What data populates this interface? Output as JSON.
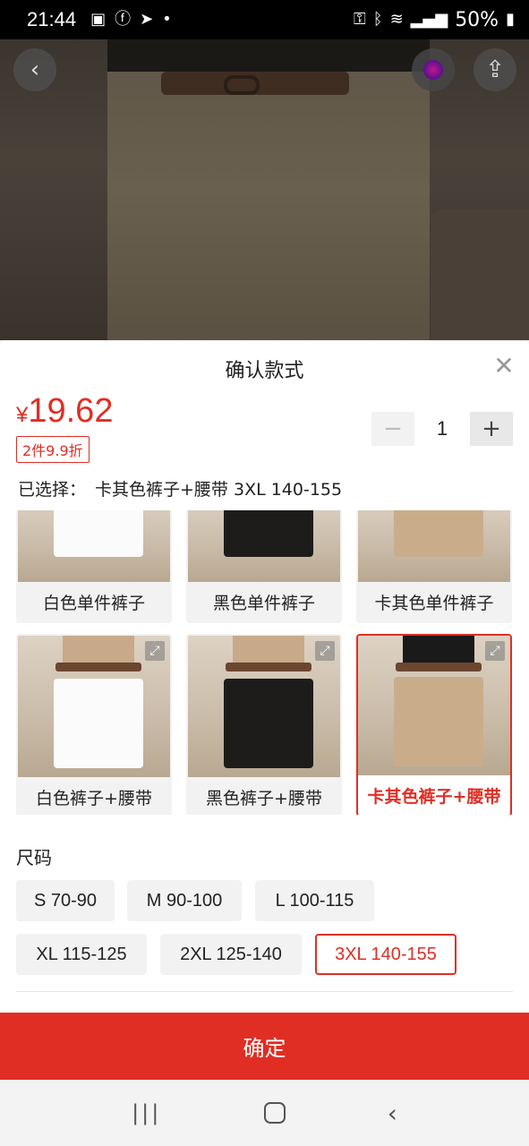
{
  "status_bar": {
    "time": "21:44",
    "battery": "50%"
  },
  "sheet": {
    "title": "确认款式",
    "price_symbol": "¥",
    "price_value": "19.62",
    "promo": "2件9.9折",
    "quantity": "1",
    "minus_label": "−",
    "plus_label": "+",
    "selected_prefix": "已选择：",
    "selected_value": "卡其色裤子+腰带 3XL 140-155"
  },
  "variants": [
    {
      "label": "白色单件裤子",
      "color": "white"
    },
    {
      "label": "黑色单件裤子",
      "color": "black"
    },
    {
      "label": "卡其色单件裤子",
      "color": "khaki"
    },
    {
      "label": "白色裤子+腰带",
      "color": "white"
    },
    {
      "label": "黑色裤子+腰带",
      "color": "black"
    },
    {
      "label": "卡其色裤子+腰带",
      "color": "khaki",
      "selected": true
    }
  ],
  "size_section": {
    "title": "尺码",
    "options": [
      "S 70-90",
      "M 90-100",
      "L 100-115",
      "XL 115-125",
      "2XL 125-140",
      "3XL 140-155"
    ],
    "selected": "3XL 140-155"
  },
  "confirm_label": "确定",
  "colors": {
    "accent": "#e02e24"
  }
}
